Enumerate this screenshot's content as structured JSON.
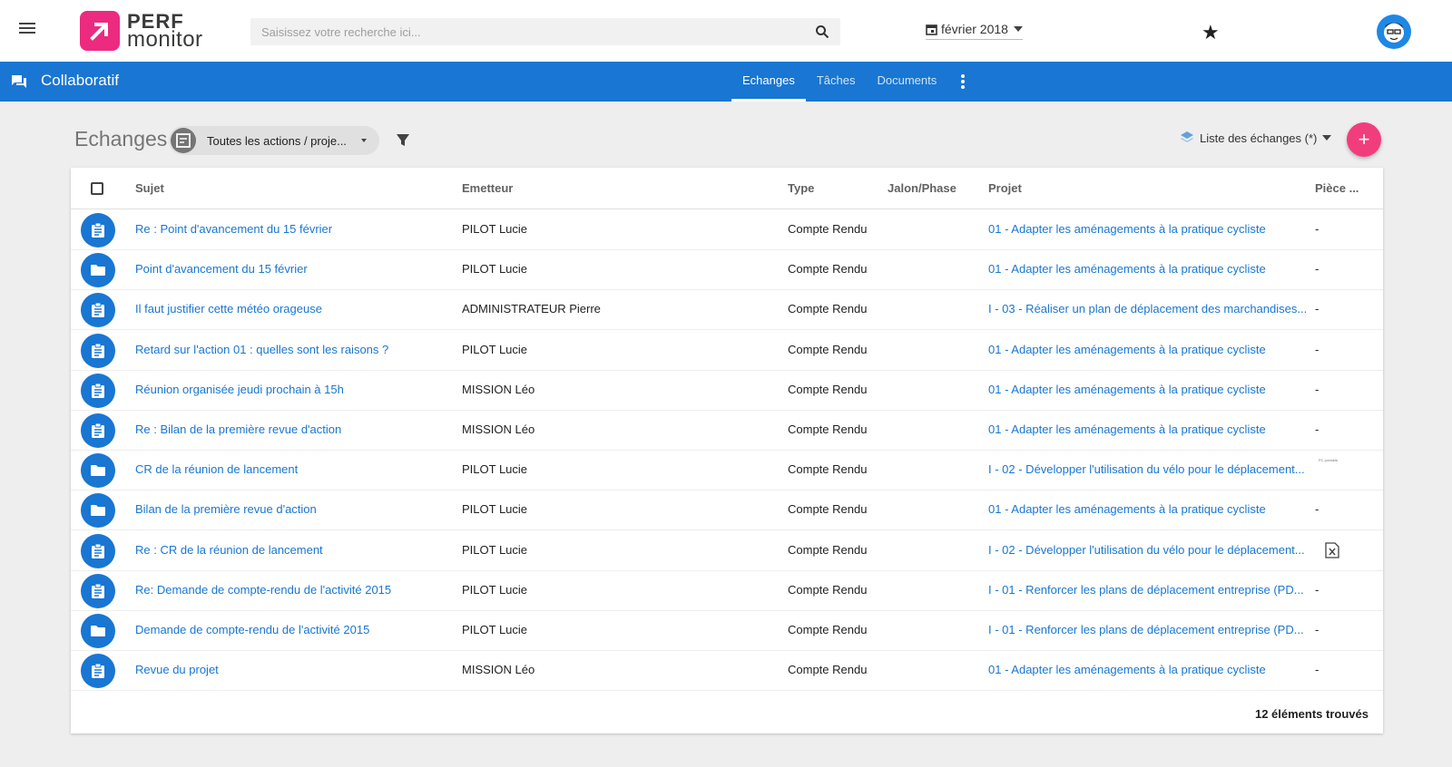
{
  "app": {
    "logo_line1": "PERF",
    "logo_line2": "monitor",
    "brand_color": "#ec2a7f",
    "primary_color": "#1976d2",
    "accent_color": "#f23d7d"
  },
  "search": {
    "placeholder": "Saisissez votre recherche ici..."
  },
  "date_selector": {
    "value": "février 2018"
  },
  "module": {
    "title": "Collaboratif",
    "tabs": [
      {
        "label": "Echanges",
        "active": true
      },
      {
        "label": "Tâches",
        "active": false
      },
      {
        "label": "Documents",
        "active": false
      }
    ]
  },
  "page": {
    "title": "Echanges",
    "scope_chip": "Toutes les actions / proje...",
    "view_selector": "Liste des échanges (*)",
    "fab_label": "+"
  },
  "table": {
    "headers": {
      "subject": "Sujet",
      "sender": "Emetteur",
      "type": "Type",
      "milestone": "Jalon/Phase",
      "project": "Projet",
      "attachment": "Pièce ..."
    },
    "rows": [
      {
        "icon": "clipboard-icon",
        "subject": "Re : Point d'avancement du 15 février",
        "sender": "PILOT Lucie",
        "type": "Compte Rendu",
        "project": "01 - Adapter les aménagements à la pratique cycliste",
        "attachment": "-"
      },
      {
        "icon": "folder-icon",
        "subject": "Point d'avancement du 15 février",
        "sender": "PILOT Lucie",
        "type": "Compte Rendu",
        "project": "01 - Adapter les aménagements à la pratique cycliste",
        "attachment": "-"
      },
      {
        "icon": "clipboard-icon",
        "subject": "Il faut justifier cette météo orageuse",
        "sender": "ADMINISTRATEUR Pierre",
        "type": "Compte Rendu",
        "project": "I - 03 - Réaliser un plan de déplacement des marchandises...",
        "attachment": "-"
      },
      {
        "icon": "clipboard-icon",
        "subject": "Retard sur l'action 01 : quelles sont les raisons ?",
        "sender": "PILOT Lucie",
        "type": "Compte Rendu",
        "project": "01 - Adapter les aménagements à la pratique cycliste",
        "attachment": "-"
      },
      {
        "icon": "clipboard-icon",
        "subject": "Réunion organisée jeudi prochain à 15h",
        "sender": "MISSION Léo",
        "type": "Compte Rendu",
        "project": "01 - Adapter les aménagements à la pratique cycliste",
        "attachment": "-"
      },
      {
        "icon": "clipboard-icon",
        "subject": "Re : Bilan de la première revue d'action",
        "sender": "MISSION Léo",
        "type": "Compte Rendu",
        "project": "01 - Adapter les aménagements à la pratique cycliste",
        "attachment": "-"
      },
      {
        "icon": "folder-icon",
        "subject": "CR de la réunion de lancement",
        "sender": "PILOT Lucie",
        "type": "Compte Rendu",
        "project": "I - 02 - Développer l'utilisation du vélo pour le déplacement...",
        "attachment": "",
        "thumb_text": "PC portable"
      },
      {
        "icon": "folder-icon",
        "subject": "Bilan de la première revue d'action",
        "sender": "PILOT Lucie",
        "type": "Compte Rendu",
        "project": "01 - Adapter les aménagements à la pratique cycliste",
        "attachment": "-"
      },
      {
        "icon": "clipboard-icon",
        "subject": "Re : CR de la réunion de lancement",
        "sender": "PILOT Lucie",
        "type": "Compte Rendu",
        "project": "I - 02 - Développer l'utilisation du vélo pour le déplacement...",
        "attachment": "",
        "attachment_icon": "excel-file-icon"
      },
      {
        "icon": "clipboard-icon",
        "subject": "Re: Demande de compte-rendu de l'activité 2015",
        "sender": "PILOT Lucie",
        "type": "Compte Rendu",
        "project": "I - 01 - Renforcer les plans de déplacement entreprise (PD...",
        "attachment": "-"
      },
      {
        "icon": "folder-icon",
        "subject": "Demande de compte-rendu de l'activité 2015",
        "sender": "PILOT Lucie",
        "type": "Compte Rendu",
        "project": "I - 01 - Renforcer les plans de déplacement entreprise (PD...",
        "attachment": "-"
      },
      {
        "icon": "clipboard-icon",
        "subject": "Revue du projet",
        "sender": "MISSION Léo",
        "type": "Compte Rendu",
        "project": "01 - Adapter les aménagements à la pratique cycliste",
        "attachment": "-"
      }
    ],
    "footer": "12 éléments trouvés"
  }
}
